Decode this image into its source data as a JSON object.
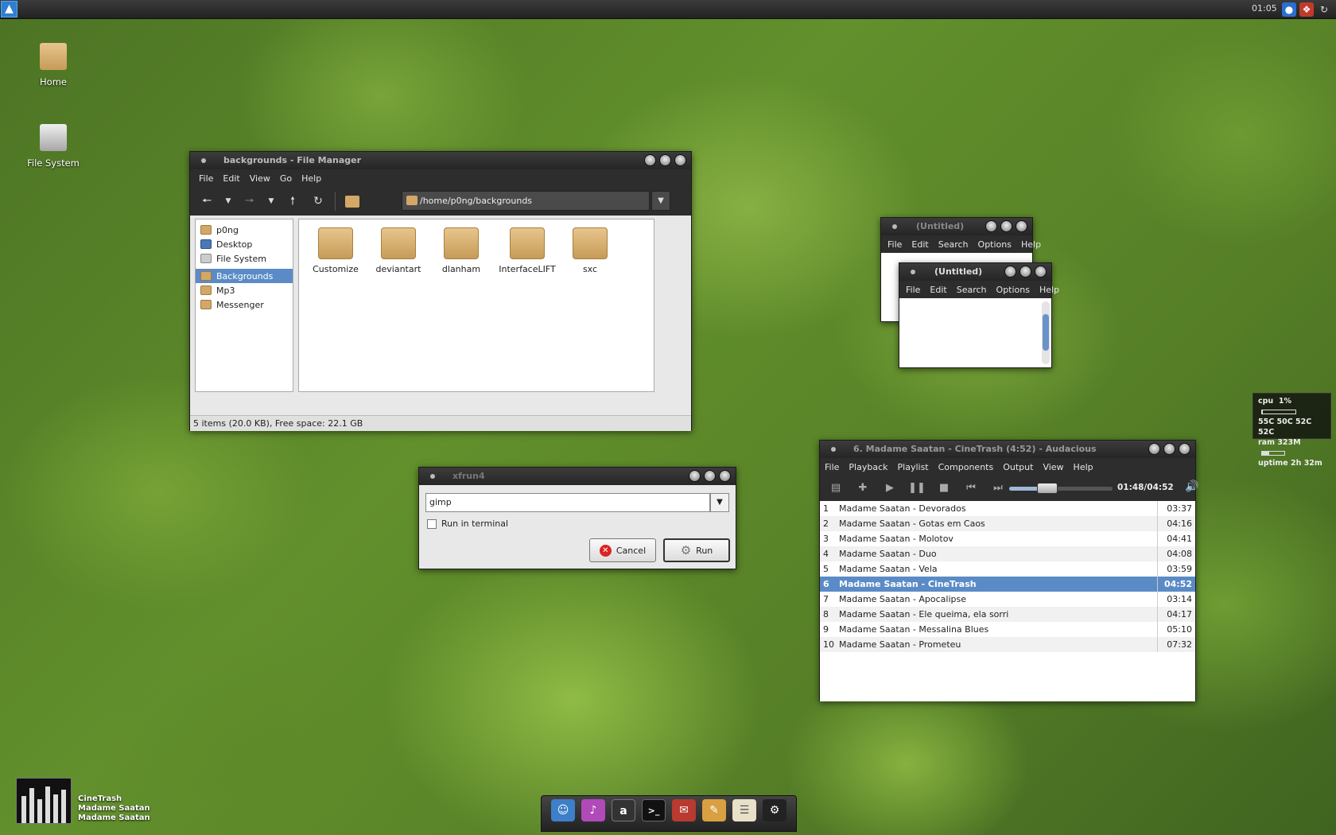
{
  "topbar": {
    "clock": "01:05"
  },
  "desktop_icons": {
    "home": "Home",
    "filesystem": "File System"
  },
  "file_manager": {
    "title": "backgrounds - File Manager",
    "menu": [
      "File",
      "Edit",
      "View",
      "Go",
      "Help"
    ],
    "path": "/home/p0ng/backgrounds",
    "sidebar": [
      "p0ng",
      "Desktop",
      "File System",
      "Backgrounds",
      "Mp3",
      "Messenger"
    ],
    "items": [
      "Customize",
      "deviantart",
      "dlanham",
      "InterfaceLIFT",
      "sxc"
    ],
    "status": "5 items (20.0 KB), Free space: 22.1 GB"
  },
  "editor_back": {
    "title": "(Untitled)",
    "menu": [
      "File",
      "Edit",
      "Search",
      "Options",
      "Help"
    ]
  },
  "editor_front": {
    "title": "(Untitled)",
    "menu": [
      "File",
      "Edit",
      "Search",
      "Options",
      "Help"
    ]
  },
  "xfrun": {
    "title": "xfrun4",
    "command": "gimp",
    "run_in_terminal": "Run in terminal",
    "cancel_label": "Cancel",
    "run_label": "Run"
  },
  "audacious": {
    "title": "6. Madame Saatan - CineTrash (4:52) - Audacious",
    "menu": [
      "File",
      "Playback",
      "Playlist",
      "Components",
      "Output",
      "View",
      "Help"
    ],
    "time": "01:48/04:52",
    "progress": 0.37,
    "current_index": 5,
    "playlist": [
      {
        "n": "1",
        "title": "Madame Saatan - Devorados",
        "len": "03:37"
      },
      {
        "n": "2",
        "title": "Madame Saatan - Gotas em Caos",
        "len": "04:16"
      },
      {
        "n": "3",
        "title": "Madame Saatan - Molotov",
        "len": "04:41"
      },
      {
        "n": "4",
        "title": "Madame Saatan - Duo",
        "len": "04:08"
      },
      {
        "n": "5",
        "title": "Madame Saatan - Vela",
        "len": "03:59"
      },
      {
        "n": "6",
        "title": "Madame Saatan - CineTrash",
        "len": "04:52"
      },
      {
        "n": "7",
        "title": "Madame Saatan - Apocalipse",
        "len": "03:14"
      },
      {
        "n": "8",
        "title": "Madame Saatan - Ele queima, ela sorri",
        "len": "04:17"
      },
      {
        "n": "9",
        "title": "Madame Saatan - Messalina Blues",
        "len": "05:10"
      },
      {
        "n": "10",
        "title": "Madame Saatan - Prometeu",
        "len": "07:32"
      }
    ]
  },
  "conky": {
    "cpu_label": "cpu",
    "cpu": "1%",
    "cpu_level": 0.01,
    "temps": "55C 50C  52C  52C",
    "ram_label": "ram",
    "ram": "323M",
    "ram_level": 0.33,
    "uptime_label": "uptime",
    "uptime": "2h 32m"
  },
  "now_playing": {
    "track": "CineTrash",
    "artist": "Madame Saatan",
    "album": "Madame Saatan"
  },
  "dock_icons": [
    "finder-icon",
    "chat-icon",
    "amarok-icon",
    "terminal-icon",
    "mail-icon",
    "paint-icon",
    "notes-icon",
    "settings-icon"
  ],
  "colors": {
    "selection": "#5b8bc6",
    "titlebar": "#2d2d2d"
  }
}
